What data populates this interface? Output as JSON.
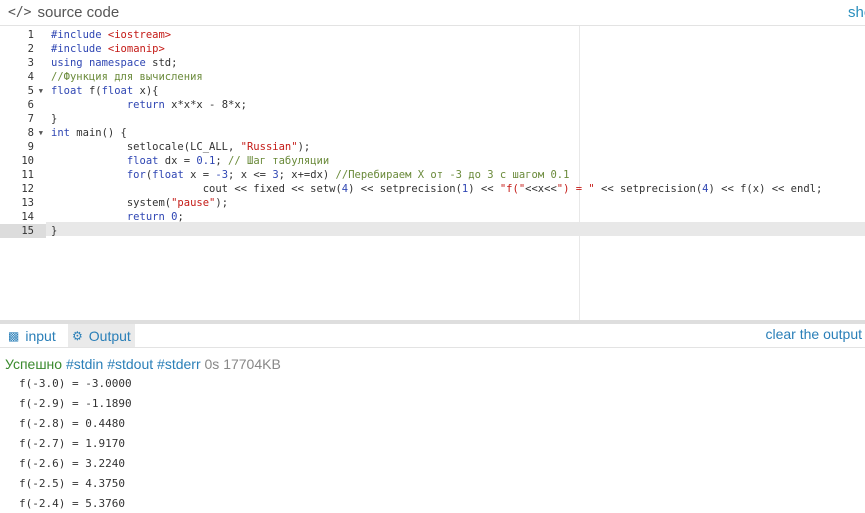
{
  "header": {
    "icon": "code-icon",
    "title": "source code",
    "show_link": "show"
  },
  "editor": {
    "active_line": 15,
    "lines": [
      [
        {
          "t": "#include ",
          "c": "k"
        },
        {
          "t": "<iostream>",
          "c": "s"
        }
      ],
      [
        {
          "t": "#include ",
          "c": "k"
        },
        {
          "t": "<iomanip>",
          "c": "s"
        }
      ],
      [
        {
          "t": "using ",
          "c": "k"
        },
        {
          "t": "namespace ",
          "c": "k"
        },
        {
          "t": "std;",
          "c": "n"
        }
      ],
      [
        {
          "t": "//Функция для вычисления",
          "c": "c"
        }
      ],
      [
        {
          "t": "float ",
          "c": "k"
        },
        {
          "t": "f(",
          "c": "n"
        },
        {
          "t": "float ",
          "c": "k"
        },
        {
          "t": "x){",
          "c": "n"
        }
      ],
      [
        {
          "t": "            ",
          "c": "n"
        },
        {
          "t": "return ",
          "c": "k"
        },
        {
          "t": "x*x*x - 8*x;",
          "c": "n"
        }
      ],
      [
        {
          "t": "}",
          "c": "n"
        }
      ],
      [
        {
          "t": "int ",
          "c": "k"
        },
        {
          "t": "main() {",
          "c": "n"
        }
      ],
      [
        {
          "t": "            setlocale(LC_ALL, ",
          "c": "n"
        },
        {
          "t": "\"Russian\"",
          "c": "s"
        },
        {
          "t": ");",
          "c": "n"
        }
      ],
      [
        {
          "t": "            ",
          "c": "n"
        },
        {
          "t": "float ",
          "c": "k"
        },
        {
          "t": "dx = ",
          "c": "n"
        },
        {
          "t": "0.1",
          "c": "k"
        },
        {
          "t": "; ",
          "c": "n"
        },
        {
          "t": "// Шаг табуляции",
          "c": "c"
        }
      ],
      [
        {
          "t": "            ",
          "c": "n"
        },
        {
          "t": "for",
          "c": "k"
        },
        {
          "t": "(",
          "c": "n"
        },
        {
          "t": "float ",
          "c": "k"
        },
        {
          "t": "x = ",
          "c": "n"
        },
        {
          "t": "-3",
          "c": "k"
        },
        {
          "t": "; x <= ",
          "c": "n"
        },
        {
          "t": "3",
          "c": "k"
        },
        {
          "t": "; x+=dx) ",
          "c": "n"
        },
        {
          "t": "//Перебираем X от -3 до 3 с шагом 0.1",
          "c": "c"
        }
      ],
      [
        {
          "t": "                        cout << fixed << setw(",
          "c": "n"
        },
        {
          "t": "4",
          "c": "k"
        },
        {
          "t": ") << setprecision(",
          "c": "n"
        },
        {
          "t": "1",
          "c": "k"
        },
        {
          "t": ") << ",
          "c": "n"
        },
        {
          "t": "\"f(\"",
          "c": "s"
        },
        {
          "t": "<<x<<",
          "c": "n"
        },
        {
          "t": "\") = \"",
          "c": "s"
        },
        {
          "t": " << setprecision(",
          "c": "n"
        },
        {
          "t": "4",
          "c": "k"
        },
        {
          "t": ") << f(x) << endl;",
          "c": "n"
        }
      ],
      [
        {
          "t": "            system(",
          "c": "n"
        },
        {
          "t": "\"pause\"",
          "c": "s"
        },
        {
          "t": ");",
          "c": "n"
        }
      ],
      [
        {
          "t": "            ",
          "c": "n"
        },
        {
          "t": "return ",
          "c": "k"
        },
        {
          "t": "0",
          "c": "k"
        },
        {
          "t": ";",
          "c": "n"
        }
      ],
      [
        {
          "t": "}",
          "c": "n"
        }
      ]
    ],
    "fold_lines": [
      5,
      8
    ]
  },
  "io": {
    "input_tab": "input",
    "input_icon": "keyboard-icon",
    "output_tab": "Output",
    "output_icon": "gears-icon",
    "clear_link": "clear the output"
  },
  "status": {
    "result": "Успешно",
    "tags": [
      "#stdin",
      "#stdout",
      "#stderr"
    ],
    "time": "0s",
    "memory": "17704KB"
  },
  "output_lines": [
    "f(-3.0) = -3.0000",
    "f(-2.9) = -1.1890",
    "f(-2.8) = 0.4480",
    "f(-2.7) = 1.9170",
    "f(-2.6) = 3.2240",
    "f(-2.5) = 4.3750",
    "f(-2.4) = 5.3760"
  ]
}
